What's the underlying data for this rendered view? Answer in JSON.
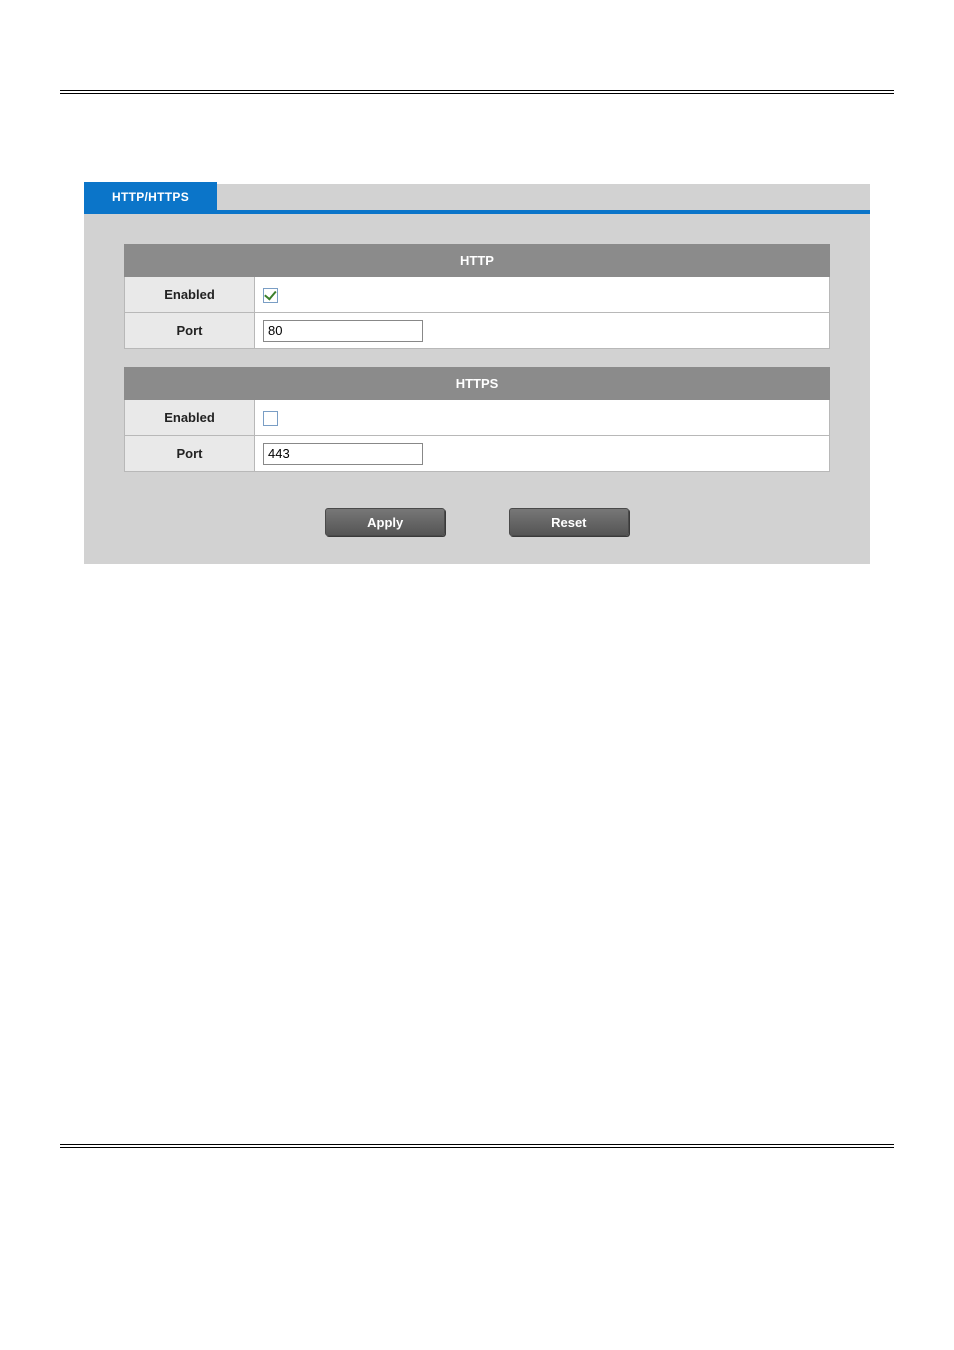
{
  "tab": {
    "label": "HTTP/HTTPS"
  },
  "http": {
    "title": "HTTP",
    "enabled_label": "Enabled",
    "enabled": true,
    "port_label": "Port",
    "port_value": "80"
  },
  "https": {
    "title": "HTTPS",
    "enabled_label": "Enabled",
    "enabled": false,
    "port_label": "Port",
    "port_value": "443"
  },
  "buttons": {
    "apply": "Apply",
    "reset": "Reset"
  }
}
